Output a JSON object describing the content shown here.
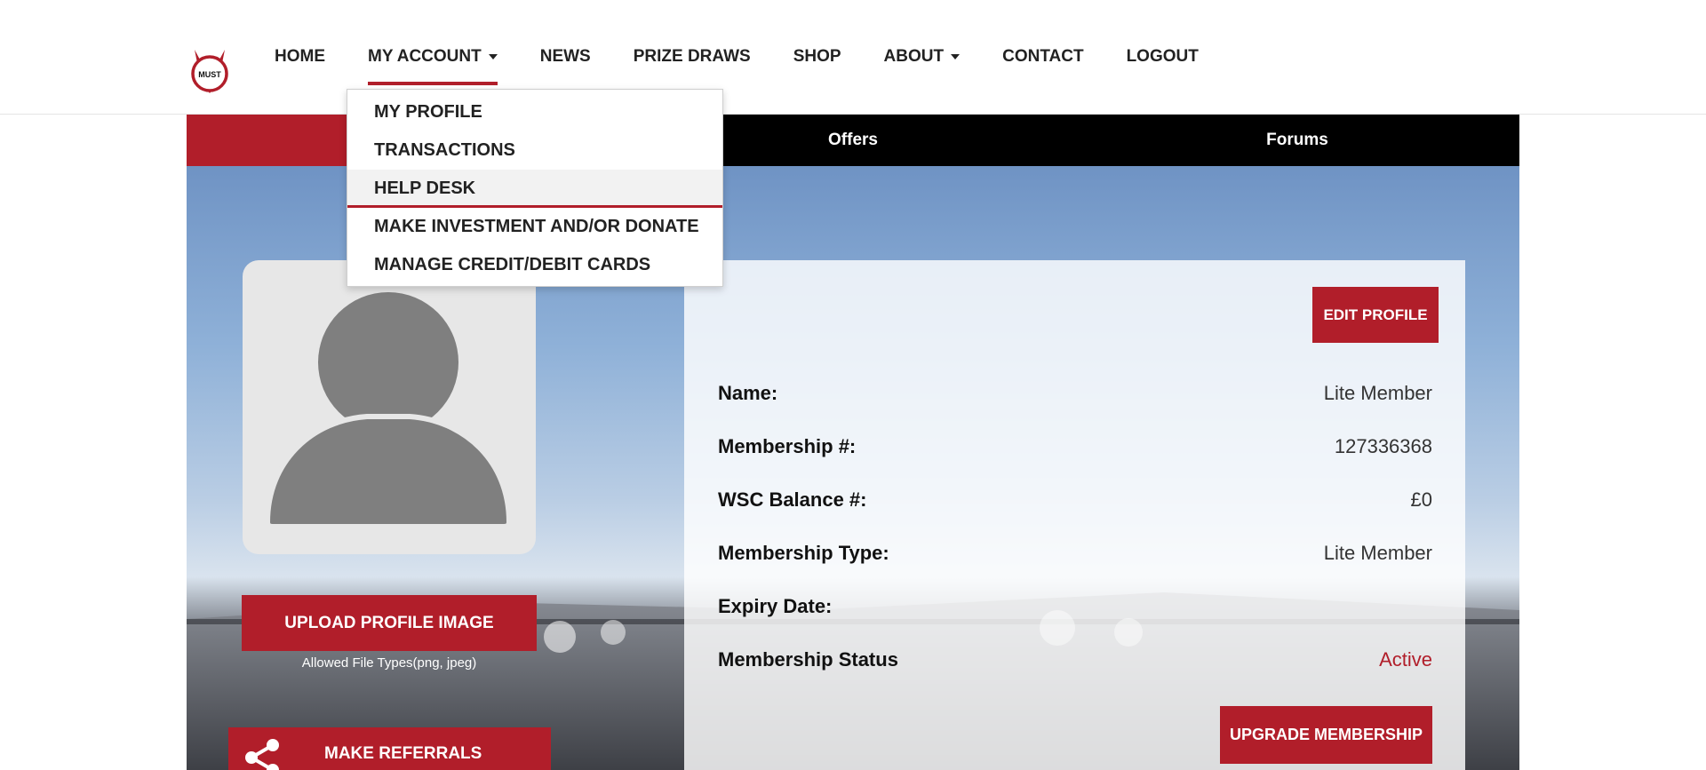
{
  "header": {
    "logo_text": "MUST",
    "nav": [
      {
        "label": "HOME"
      },
      {
        "label": "MY ACCOUNT"
      },
      {
        "label": "NEWS"
      },
      {
        "label": "PRIZE DRAWS"
      },
      {
        "label": "SHOP"
      },
      {
        "label": "ABOUT"
      },
      {
        "label": "CONTACT"
      },
      {
        "label": "LOGOUT"
      }
    ]
  },
  "dropdown": {
    "items": [
      {
        "label": "MY PROFILE"
      },
      {
        "label": "TRANSACTIONS"
      },
      {
        "label": "HELP DESK"
      },
      {
        "label": "MAKE INVESTMENT AND/OR DONATE"
      },
      {
        "label": "MANAGE CREDIT/DEBIT CARDS"
      }
    ]
  },
  "tabs": {
    "offers": "Offers",
    "forums": "Forums"
  },
  "left": {
    "upload_label": "UPLOAD PROFILE IMAGE",
    "allowed_types": "Allowed File Types(png, jpeg)",
    "referrals_label": "MAKE REFERRALS"
  },
  "profile": {
    "edit_label": "EDIT PROFILE",
    "rows": [
      {
        "label": "Name:",
        "value": "Lite Member"
      },
      {
        "label": "Membership #:",
        "value": "127336368"
      },
      {
        "label": "WSC Balance #:",
        "value": "£0"
      },
      {
        "label": "Membership Type:",
        "value": "Lite Member"
      },
      {
        "label": "Expiry Date:",
        "value": ""
      },
      {
        "label": "Membership Status",
        "value": "Active"
      }
    ],
    "upgrade_label": "UPGRADE MEMBERSHIP"
  },
  "colors": {
    "accent": "#b11e2a",
    "tab_bar_dark": "#000000"
  }
}
